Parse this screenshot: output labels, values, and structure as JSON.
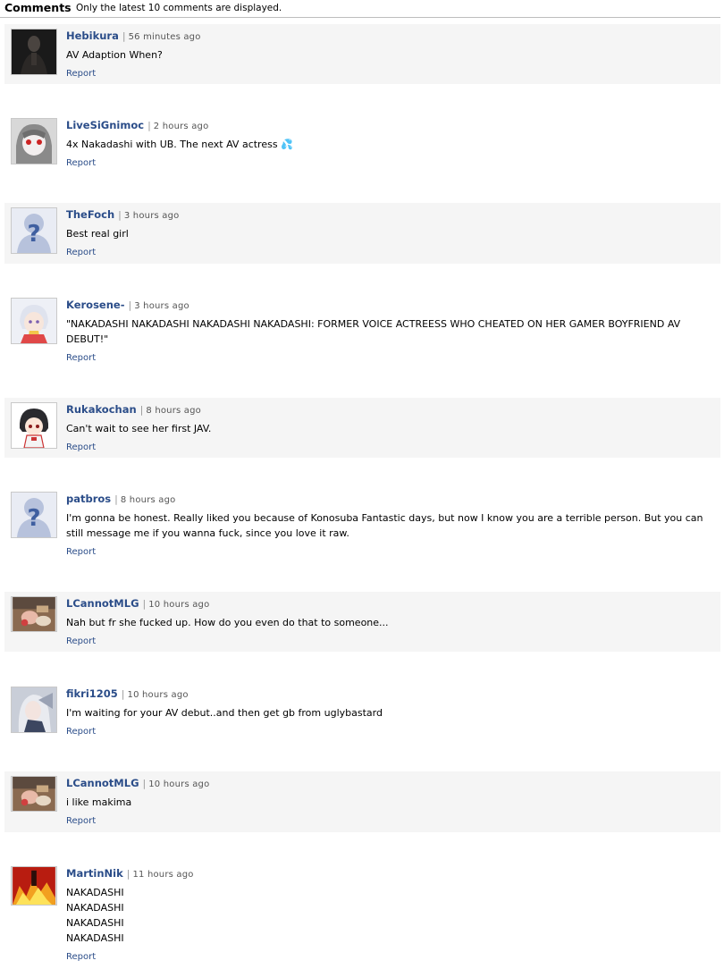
{
  "header": {
    "title": "Comments",
    "note": "Only the latest 10 comments are displayed."
  },
  "report_label": "Report",
  "comments": [
    {
      "user": "Hebikura",
      "time": "56 minutes ago",
      "lines": [
        "AV Adaption When?"
      ],
      "avatar": "dark-figure-avatar"
    },
    {
      "user": "LiveSiGnimoc",
      "time": "2 hours ago",
      "lines": [
        "4x Nakadashi with UB. The next AV actress 💦"
      ],
      "avatar": "anime-girl-red-eyes-avatar"
    },
    {
      "user": "TheFoch",
      "time": "3 hours ago",
      "lines": [
        "Best real girl"
      ],
      "avatar": "default-question-avatar"
    },
    {
      "user": "Kerosene-",
      "time": "3 hours ago",
      "lines": [
        "\"NAKADASHI NAKADASHI NAKADASHI NAKADASHI: FORMER VOICE ACTREESS WHO CHEATED ON HER GAMER BOYFRIEND AV DEBUT!\""
      ],
      "avatar": "anime-white-hair-avatar"
    },
    {
      "user": "Rukakochan",
      "time": "8 hours ago",
      "lines": [
        "Can't wait to see her first JAV."
      ],
      "avatar": "chibi-girl-avatar"
    },
    {
      "user": "patbros",
      "time": "8 hours ago",
      "lines": [
        "I'm gonna be honest. Really liked you because of Konosuba Fantastic days, but now I know you are a terrible person. But you can still message me if you wanna fuck, since you love it raw."
      ],
      "avatar": "default-question-avatar"
    },
    {
      "user": "LCannotMLG",
      "time": "10 hours ago",
      "lines": [
        "Nah but fr she fucked up. How do you even do that to someone..."
      ],
      "avatar": "food-scene-avatar"
    },
    {
      "user": "fikri1205",
      "time": "10 hours ago",
      "lines": [
        "I'm waiting for your AV debut..and then get gb from uglybastard"
      ],
      "avatar": "silver-hair-avatar"
    },
    {
      "user": "LCannotMLG",
      "time": "10 hours ago",
      "lines": [
        "i like makima"
      ],
      "avatar": "food-scene-avatar"
    },
    {
      "user": "MartinNik",
      "time": "11 hours ago",
      "lines": [
        "NAKADASHI",
        "NAKADASHI",
        "NAKADASHI",
        "NAKADASHI"
      ],
      "avatar": "red-fire-scene-avatar"
    }
  ]
}
